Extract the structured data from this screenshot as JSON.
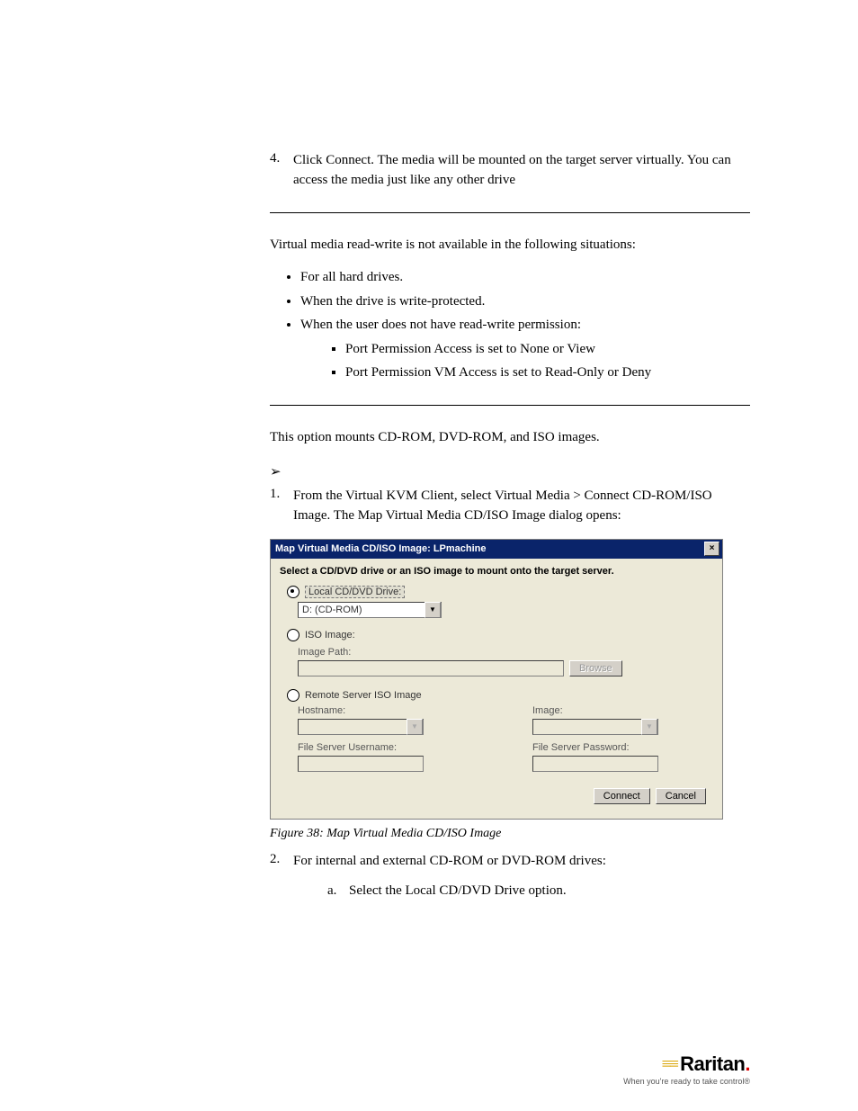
{
  "step4": {
    "number": "4.",
    "text": "Click Connect. The media will be mounted on the target server virtually. You can access the media just like any other drive"
  },
  "para_rw": "Virtual media read-write is not available in the following situations:",
  "bullets": [
    "For all hard drives.",
    "When the drive is write-protected.",
    "When the user does not have read-write permission:"
  ],
  "sub_bullets": [
    "Port Permission Access is set to None or View",
    "Port Permission VM Access is set to Read-Only or Deny"
  ],
  "para_mounts": "This option mounts CD-ROM, DVD-ROM, and ISO images.",
  "arrow": "➢",
  "step1": {
    "number": "1.",
    "text": "From the Virtual KVM Client, select Virtual Media > Connect CD-ROM/ISO Image. The Map Virtual Media CD/ISO Image dialog opens:"
  },
  "dialog": {
    "title": "Map Virtual Media CD/ISO Image: LPmachine",
    "close_x": "×",
    "heading": "Select a CD/DVD drive or an ISO image to mount onto the target server.",
    "opt_local": "Local CD/DVD Drive:",
    "local_value": "D: (CD-ROM)",
    "opt_iso": "ISO Image:",
    "img_path_label": "Image Path:",
    "browse": "Browse",
    "opt_remote": "Remote Server ISO Image",
    "hostname_label": "Hostname:",
    "image_label": "Image:",
    "fs_user_label": "File Server Username:",
    "fs_pass_label": "File Server Password:",
    "connect": "Connect",
    "cancel": "Cancel"
  },
  "caption": "Figure 38: Map Virtual Media CD/ISO Image",
  "step2": {
    "number": "2.",
    "text": "For internal and external CD-ROM or DVD-ROM drives:"
  },
  "sub_a": {
    "letter": "a.",
    "text": "Select the Local CD/DVD Drive option."
  },
  "footer": {
    "brand": "Raritan",
    "dot": ".",
    "tagline": "When you're ready to take control®"
  }
}
